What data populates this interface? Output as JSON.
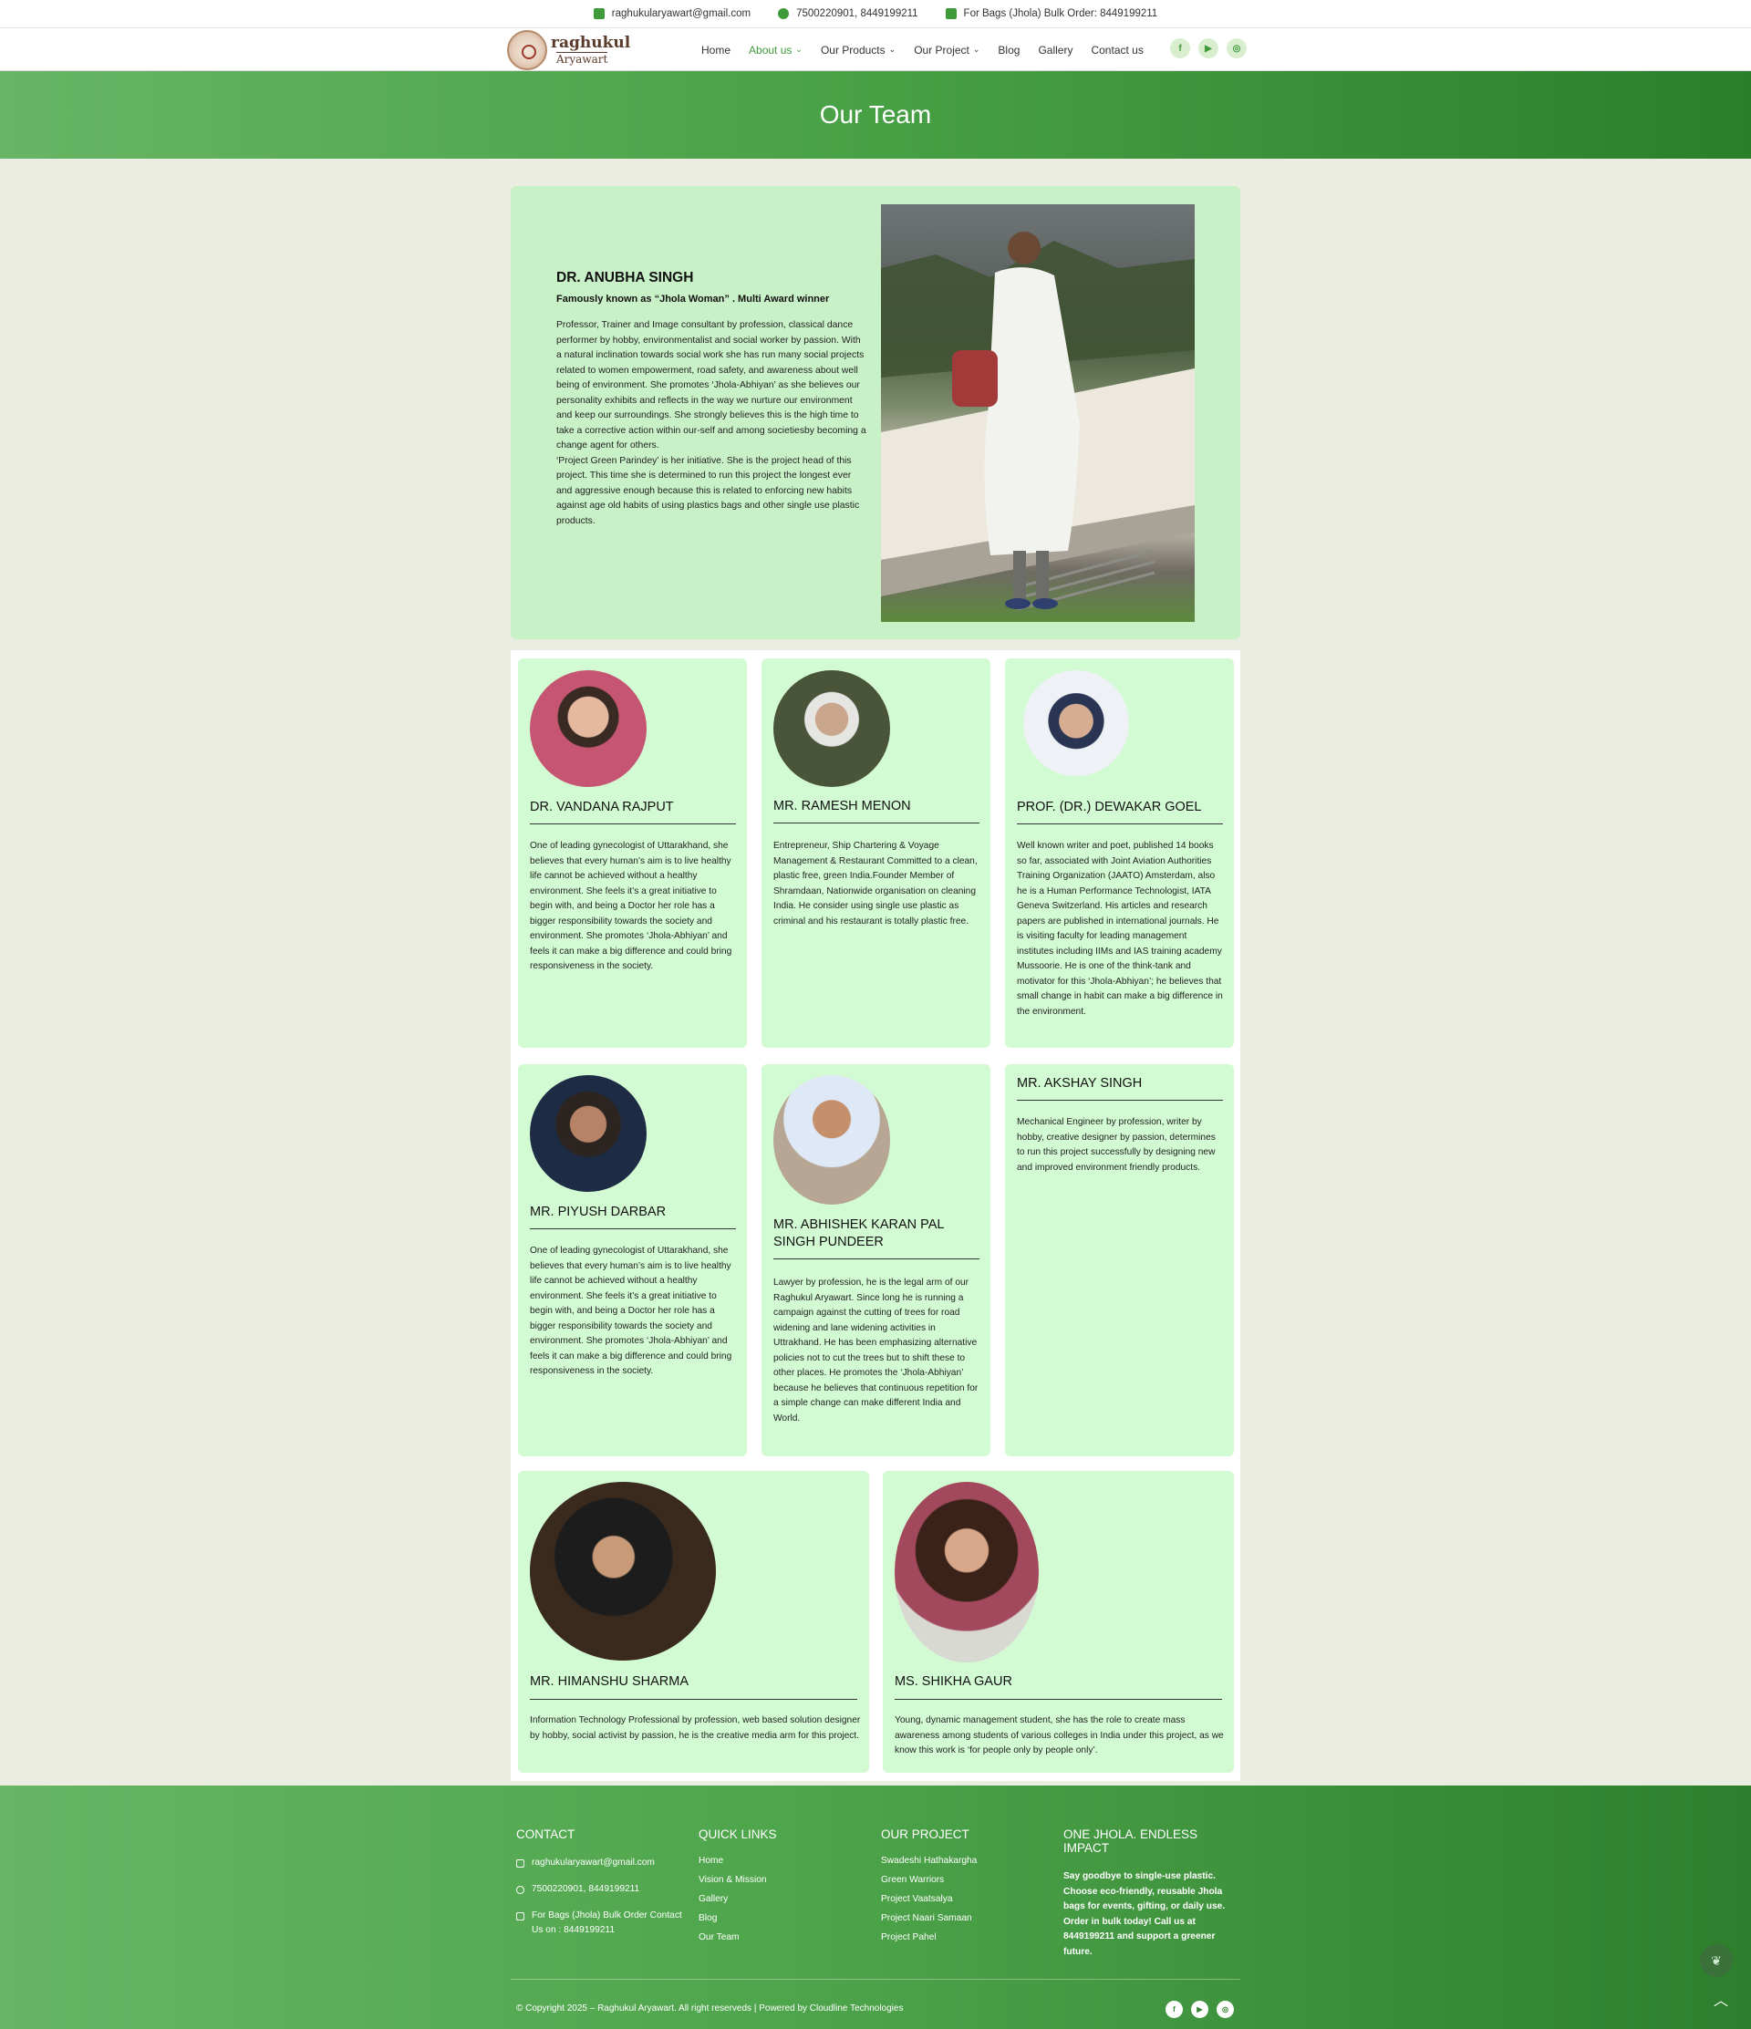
{
  "topbar": {
    "email": "raghukularyawart@gmail.com",
    "phone": "7500220901, 8449199211",
    "bulk": "For Bags (Jhola) Bulk Order: 8449199211"
  },
  "logo": {
    "line1": "raghukul",
    "line2": "Aryawart"
  },
  "nav": {
    "home": "Home",
    "about": "About us",
    "products": "Our Products",
    "project": "Our Project",
    "blog": "Blog",
    "gallery": "Gallery",
    "contact": "Contact us"
  },
  "socials": [
    "facebook-icon",
    "youtube-icon",
    "instagram-icon"
  ],
  "banner": {
    "title": "Our Team"
  },
  "hero": {
    "name": "DR. ANUBHA SINGH",
    "subtitle": "Famously known as “Jhola Woman” . Multi Award winner",
    "description": "Professor, Trainer and Image consultant by profession, classical dance performer by hobby, environmentalist and social worker by passion. With a natural inclination towards social work she has run many social projects related to women empowerment, road safety, and awareness about well being of environment. She promotes ‘Jhola-Abhiyan’ as she believes our personality exhibits and reflects in the way we nurture our environment and keep our surroundings. She strongly believes this is the high time to take a corrective action within our-self and among societiesby becoming a change agent for others.\n‘Project Green Parindey’ is her initiative. She is the project head of this project. This time she is determined to run this project the longest ever and aggressive enough because this is related to enforcing new habits against age old habits of using plastics bags and other single use plastic products."
  },
  "team": [
    {
      "name": "DR. VANDANA RAJPUT",
      "description": "One of leading gynecologist of Uttarakhand, she believes that every human’s aim is to live healthy life cannot be achieved without a healthy environment. She feels it’s a great initiative to begin with, and being a Doctor her role has a bigger responsibility towards the society and environment. She promotes ‘Jhola-Abhiyan’ and feels it can make a big difference and could bring responsiveness in the society."
    },
    {
      "name": "MR. RAMESH MENON",
      "description": "Entrepreneur, Ship Chartering & Voyage Management & Restaurant Committed to a clean, plastic free, green India.Founder Member of Shramdaan, Nationwide organisation on cleaning India. He consider using single use plastic as criminal and his restaurant is totally plastic free."
    },
    {
      "name": "PROF. (DR.) DEWAKAR GOEL",
      "description": "Well known writer and poet, published 14 books so far, associated with Joint Aviation Authorities Training Organization (JAATO) Amsterdam, also he is a Human Performance Technologist, IATA Geneva Switzerland. His articles and research papers are published in international journals. He is visiting faculty for leading management institutes including IIMs and IAS training academy Mussoorie. He is one of the think-tank and motivator for this ‘Jhola-Abhiyan’; he believes that small change in habit can make a big difference in the environment."
    },
    {
      "name": "MR. PIYUSH DARBAR",
      "description": "One of leading gynecologist of Uttarakhand, she believes that every human’s aim is to live healthy life cannot be achieved without a healthy environment. She feels it’s a great initiative to begin with, and being a Doctor her role has a bigger responsibility towards the society and environment. She promotes ‘Jhola-Abhiyan’ and feels it can make a big difference and could bring responsiveness in the society."
    },
    {
      "name": "MR. ABHISHEK KARAN PAL SINGH PUNDEER",
      "description": "Lawyer by profession, he is the legal arm of our Raghukul Aryawart. Since long he is running a campaign against the cutting of trees for road widening and lane widening activities in Uttrakhand. He has been emphasizing alternative policies not to cut the trees but to shift these to other places. He promotes the ‘Jhola-Abhiyan’ because he believes that continuous repetition for a simple change can make different India and World."
    },
    {
      "name": "MR. AKSHAY SINGH",
      "description": "Mechanical Engineer by profession, writer by hobby, creative designer by passion, determines to run this project successfully by designing new and improved environment friendly products."
    },
    {
      "name": "MR. HIMANSHU SHARMA",
      "description": "Information Technology Professional by profession, web based solution designer by hobby, social activist by passion, he is the creative media arm for this project."
    },
    {
      "name": "MS. SHIKHA GAUR",
      "description": "Young, dynamic management student, she has the role to create mass awareness among students of various colleges in India under this project, as we know this work is ‘for people only by people only’."
    }
  ],
  "footer": {
    "contact": {
      "heading": "CONTACT",
      "email": "raghukularyawart@gmail.com",
      "phone": "7500220901, 8449199211",
      "bulk": "For Bags (Jhola) Bulk Order Contact Us on : 8449199211"
    },
    "quick_links": {
      "heading": "QUICK LINKS",
      "items": [
        "Home",
        "Vision & Mission",
        "Gallery",
        "Blog",
        "Our Team"
      ]
    },
    "our_project": {
      "heading": "OUR PROJECT",
      "items": [
        "Swadeshi Hathakargha",
        "Green Warriors",
        "Project Vaatsalya",
        "Project Naari Samaan",
        "Project Pahel"
      ]
    },
    "impact": {
      "heading": "ONE JHOLA. ENDLESS IMPACT",
      "text": "Say goodbye to single-use plastic. Choose eco-friendly, reusable Jhola bags for events, gifting, or daily use. Order in bulk today! Call us at 8449199211 and support a greener future."
    },
    "copyright": "© Copyright 2025 – Raghukul Aryawart. All right reserveds | Powered by Cloudline Technologies"
  }
}
